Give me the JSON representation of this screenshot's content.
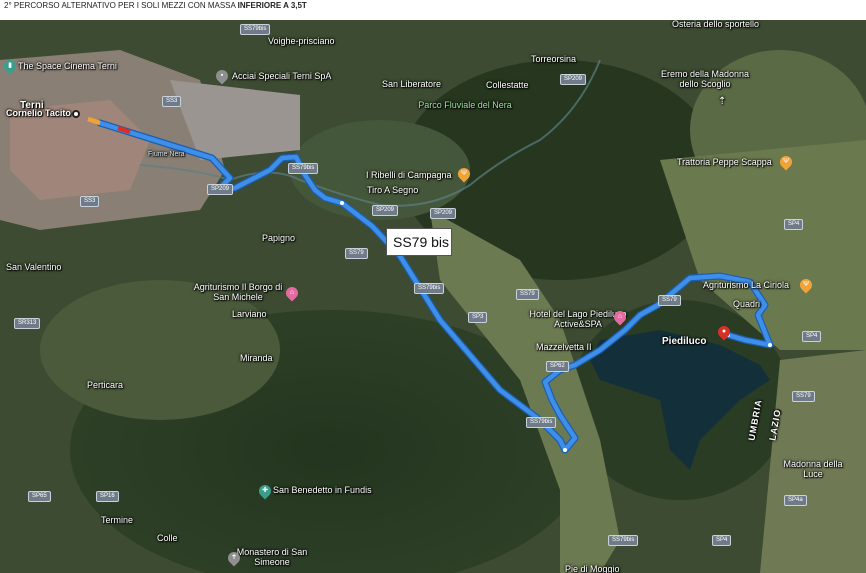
{
  "title": {
    "text_normal": "2° PERCORSO ALTERNATIVO PER I SOLI MEZZI CON MASSA ",
    "text_bold": "INFERIORE A 3,5T"
  },
  "callout": {
    "text": "SS79 bis"
  },
  "places": [
    {
      "text": "Terni",
      "bold": true
    },
    {
      "text": "Cornelio Tacito"
    },
    {
      "text": "The Space Cinema Terni"
    },
    {
      "text": "Voighe-prisciano"
    },
    {
      "text": "Acciai Speciali Terni SpA"
    },
    {
      "text": "San Liberatore"
    },
    {
      "text": "Collestatte"
    },
    {
      "text": "Torreorsina"
    },
    {
      "text": "Parco Fluviale del Nera"
    },
    {
      "text": "Eremo della Madonna dello Scoglio"
    },
    {
      "text": "Osteria dello sportello"
    },
    {
      "text": "Trattoria Peppe Scappa"
    },
    {
      "text": "I Ribelli di Campagna"
    },
    {
      "text": "Tiro A Segno"
    },
    {
      "text": "Papigno"
    },
    {
      "text": "San Valentino"
    },
    {
      "text": "Agriturismo Il Borgo di San Michele"
    },
    {
      "text": "Larviano"
    },
    {
      "text": "Miranda"
    },
    {
      "text": "Perticara"
    },
    {
      "text": "Hotel del Lago Piediluco Active&SPA"
    },
    {
      "text": "Mazzelvetta II"
    },
    {
      "text": "Agriturismo La Ciriola"
    },
    {
      "text": "Quadri"
    },
    {
      "text": "Piediluco",
      "bold": true
    },
    {
      "text": "UMBRIA"
    },
    {
      "text": "LAZIO"
    },
    {
      "text": "Madonna della Luce"
    },
    {
      "text": "San Benedetto in Fundis"
    },
    {
      "text": "Monastero di San Simeone"
    },
    {
      "text": "Termine"
    },
    {
      "text": "Colle"
    },
    {
      "text": "Fiume Nera"
    },
    {
      "text": "Pie di Moggio"
    }
  ],
  "road_shields": [
    "SS79bis",
    "SP209",
    "SS3",
    "SS3",
    "SP209",
    "SS79bis",
    "SP209",
    "SS79",
    "SS79bis",
    "SS79",
    "SP3",
    "SP62",
    "SS79bis",
    "SS79",
    "SP4",
    "SP4",
    "SS79",
    "SP4a",
    "SR313",
    "SP65",
    "SP16",
    "SS79bis",
    "SP4",
    "SP209"
  ],
  "colors": {
    "route": "#3f8fe8",
    "route_outline": "#1a5fb4",
    "traffic_red": "#d93025"
  }
}
